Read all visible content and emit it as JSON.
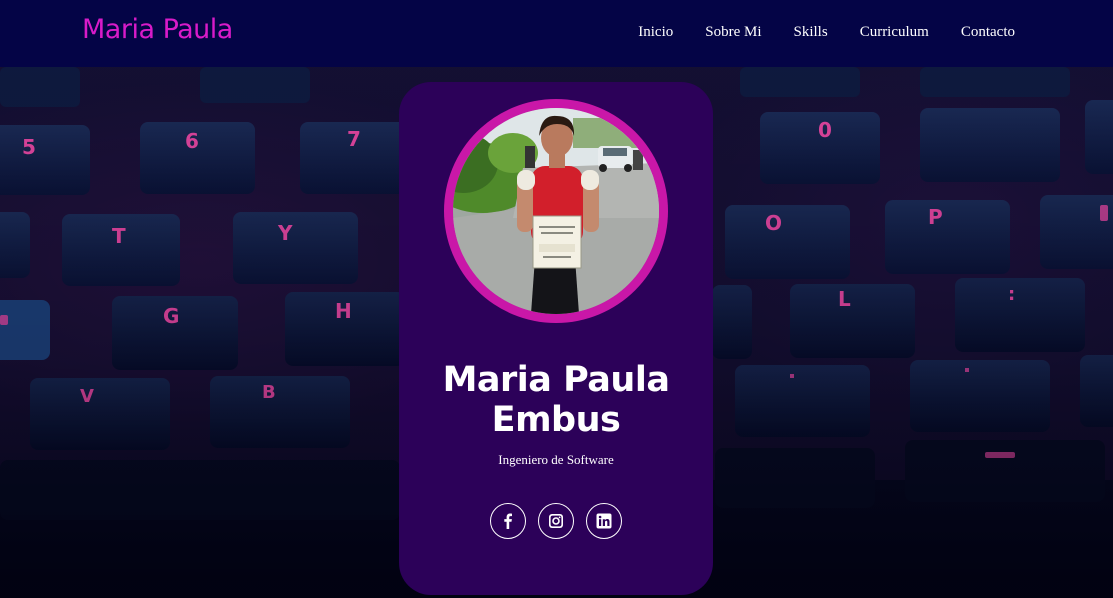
{
  "navbar": {
    "brand": "Maria Paula",
    "links": [
      {
        "label": "Inicio"
      },
      {
        "label": "Sobre Mi"
      },
      {
        "label": "Skills"
      },
      {
        "label": "Curriculum"
      },
      {
        "label": "Contacto"
      }
    ]
  },
  "card": {
    "name_line1": "Maria Paula",
    "name_line2": "Embus",
    "role": "Ingeniero de Software",
    "socials": [
      {
        "icon": "facebook-icon"
      },
      {
        "icon": "instagram-icon"
      },
      {
        "icon": "linkedin-icon"
      }
    ]
  },
  "background": {
    "key_legends": [
      "5",
      "6",
      "7",
      "T",
      "Y",
      "G",
      "H",
      "V",
      "B",
      "0",
      "O",
      "P",
      "L",
      ":"
    ]
  },
  "colors": {
    "navbar_bg": "#040446",
    "brand": "#d81bc9",
    "card_bg": "#2c0159",
    "avatar_ring": "#c917a8",
    "key_legend": "#e0459f"
  }
}
